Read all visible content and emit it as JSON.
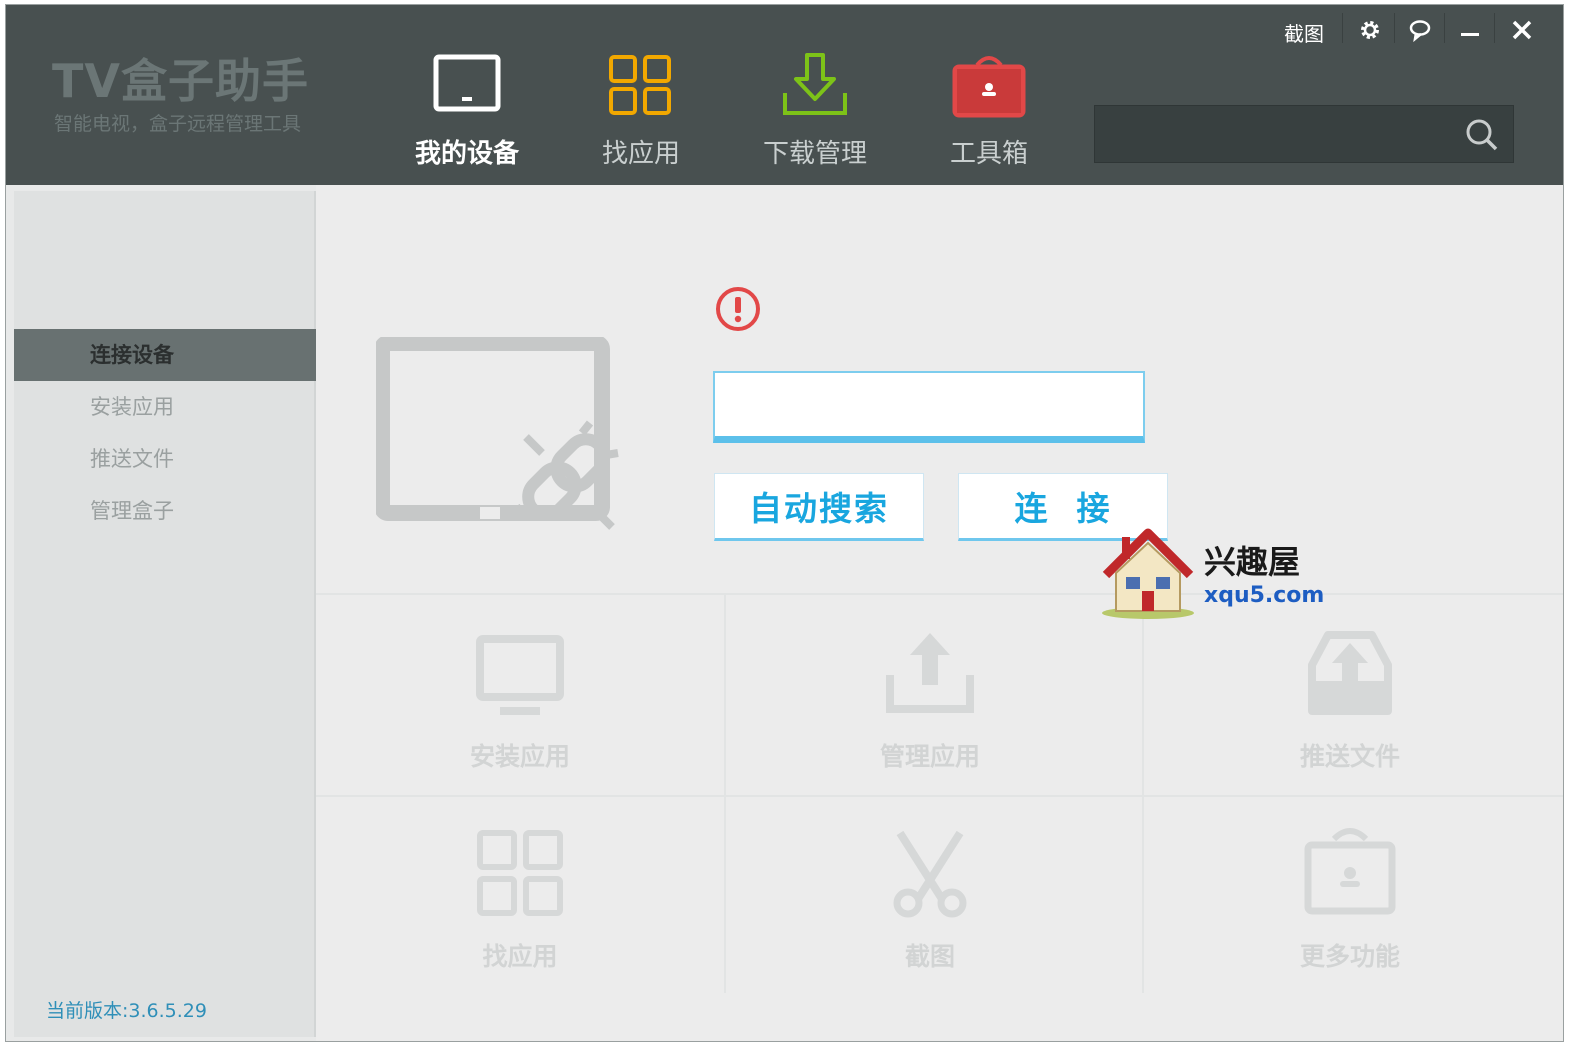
{
  "app": {
    "logo_title": "TV盒子助手",
    "logo_subtitle": "智能电视，盒子远程管理工具"
  },
  "window_controls": {
    "screenshot_label": "截图",
    "settings_icon": "gear-icon",
    "feedback_icon": "chat-bubble-icon",
    "minimize_icon": "minimize-icon",
    "close_icon": "close-icon"
  },
  "nav": {
    "items": [
      {
        "label": "我的设备",
        "icon": "monitor-icon",
        "active": true
      },
      {
        "label": "找应用",
        "icon": "grid-icon",
        "color": "#f2a800"
      },
      {
        "label": "下载管理",
        "icon": "download-icon",
        "color": "#7dc318"
      },
      {
        "label": "工具箱",
        "icon": "toolbox-icon",
        "color": "#e24848"
      }
    ]
  },
  "search": {
    "value": "",
    "icon": "search-icon"
  },
  "sidebar": {
    "items": [
      {
        "label": "连接设备",
        "active": true
      },
      {
        "label": "安装应用"
      },
      {
        "label": "推送文件"
      },
      {
        "label": "管理盒子"
      }
    ],
    "version_label": "当前版本:",
    "version_value": "3.6.5.29"
  },
  "connect": {
    "alert_icon": "exclamation-circle-icon",
    "ip_value": "",
    "auto_search_label": "自动搜索",
    "connect_label": "连  接"
  },
  "tiles": [
    {
      "label": "安装应用",
      "icon": "monitor-icon"
    },
    {
      "label": "管理应用",
      "icon": "upload-icon"
    },
    {
      "label": "推送文件",
      "icon": "inbox-upload-icon"
    },
    {
      "label": "找应用",
      "icon": "grid-icon"
    },
    {
      "label": "截图",
      "icon": "scissors-icon"
    },
    {
      "label": "更多功能",
      "icon": "toolbox-icon"
    }
  ],
  "watermark": {
    "cn": "兴趣屋",
    "en": "xqu5.com"
  },
  "colors": {
    "header_bg": "#485050",
    "accent_blue": "#19a6df",
    "sidebar_active": "#687171",
    "alert_red": "#e24848"
  }
}
